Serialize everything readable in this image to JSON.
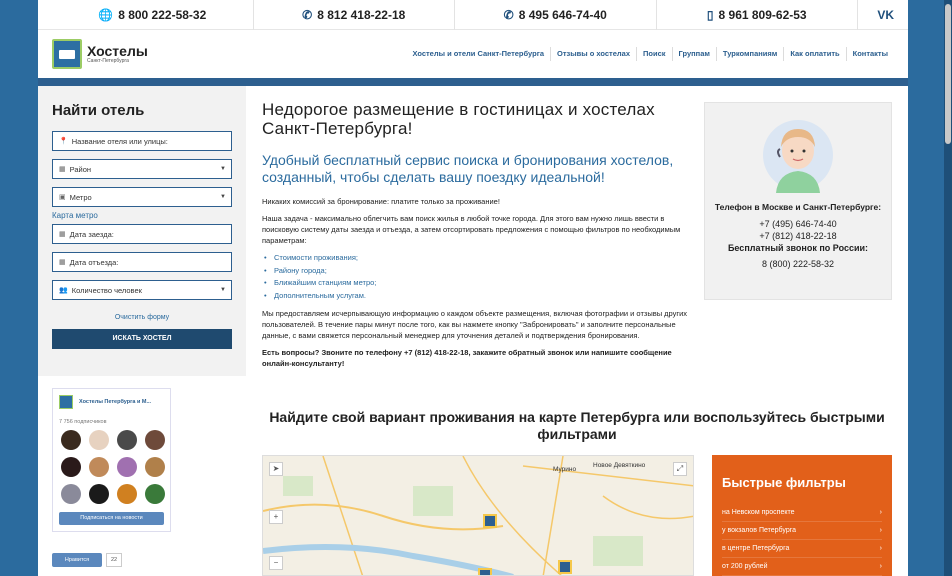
{
  "topbar": {
    "phones": [
      "8 800 222-58-32",
      "8 812 418-22-18",
      "8 495 646-74-40",
      "8 961 809-62-53"
    ],
    "vk_label": "VK"
  },
  "logo": {
    "name": "Хостелы",
    "sub": "Санкт-Петербурга"
  },
  "nav": [
    "Хостелы и отели Санкт-Петербурга",
    "Отзывы о хостелах",
    "Поиск",
    "Группам",
    "Туркомпаниям",
    "Как оплатить",
    "Контакты"
  ],
  "search": {
    "title": "Найти отель",
    "name_placeholder": "Название отеля или улицы:",
    "district": "Район",
    "metro": "Метро",
    "metro_map": "Карта метро",
    "checkin": "Дата заезда:",
    "checkout": "Дата отъезда:",
    "guests": "Количество человек",
    "clear": "Очистить форму",
    "submit": "ИСКАТЬ ХОСТЕЛ"
  },
  "vk": {
    "name": "Хостелы Петербурга и М...",
    "subscribers": "7 756 подписчиков",
    "subscribe": "Подписаться на новости",
    "avatars": [
      "#3a2a1e",
      "#e7d2c0",
      "#4a4a4a",
      "#6e4a3a",
      "#2a1a1a",
      "#c08a5a",
      "#a070b0",
      "#b0804a",
      "#8a8a9a",
      "#1a1a1a",
      "#d08020",
      "#3a7a3a"
    ]
  },
  "like": {
    "label": "Нравится",
    "count": "22"
  },
  "content": {
    "h1": "Недорогое размещение в гостиницах и хостелах Санкт-Петербурга!",
    "h2": "Удобный бесплатный сервис поиска и бронирования хостелов, созданный, чтобы сделать вашу поездку идеальной!",
    "p1": "Никаких комиссий за бронирование: платите только за проживание!",
    "p2": "Наша задача - максимально облегчить вам поиск жилья в любой точке города. Для этого вам нужно лишь ввести в поисковую систему даты заезда и отъезда, а затем отсортировать предложения с помощью фильтров по необходимым параметрам:",
    "list": [
      "Стоимости проживания;",
      "Району города;",
      "Ближайшим станциям метро;",
      "Дополнительным услугам."
    ],
    "p3": "Мы предоставляем исчерпывающую информацию о каждом объекте размещения, включая фотографии и отзывы других пользователей. В течение пары минут после того, как вы нажмете кнопку \"Забронировать\" и заполните персональные данные, с вами свяжется персональный менеджер для уточнения деталей и подтверждения бронирования.",
    "p4": "Есть вопросы? Звоните по телефону +7 (812) 418-22-18, закажите обратный звонок или напишите сообщение онлайн-консультанту!"
  },
  "contact": {
    "title": "Телефон в Москве и Санкт-Петербурге:",
    "phone1": "+7 (495) 646-74-40",
    "phone2": "+7 (812) 418-22-18",
    "free_label": "Бесплатный звонок по России:",
    "phone3": "8 (800) 222-58-32"
  },
  "map": {
    "title": "Найдите свой вариант проживания на карте Петербурга или воспользуйтесь быстрыми фильтрами",
    "labels": [
      "Мурино",
      "Новое Девяткино"
    ]
  },
  "filters": {
    "title": "Быстрые фильтры",
    "items": [
      "на Невском проспекте",
      "у вокзалов Петербурга",
      "в центре Петербурга",
      "от 200 рублей"
    ]
  },
  "colors": {
    "brand_blue": "#2d5f8f",
    "accent_orange": "#e2601a",
    "link": "#2b6b9e"
  }
}
